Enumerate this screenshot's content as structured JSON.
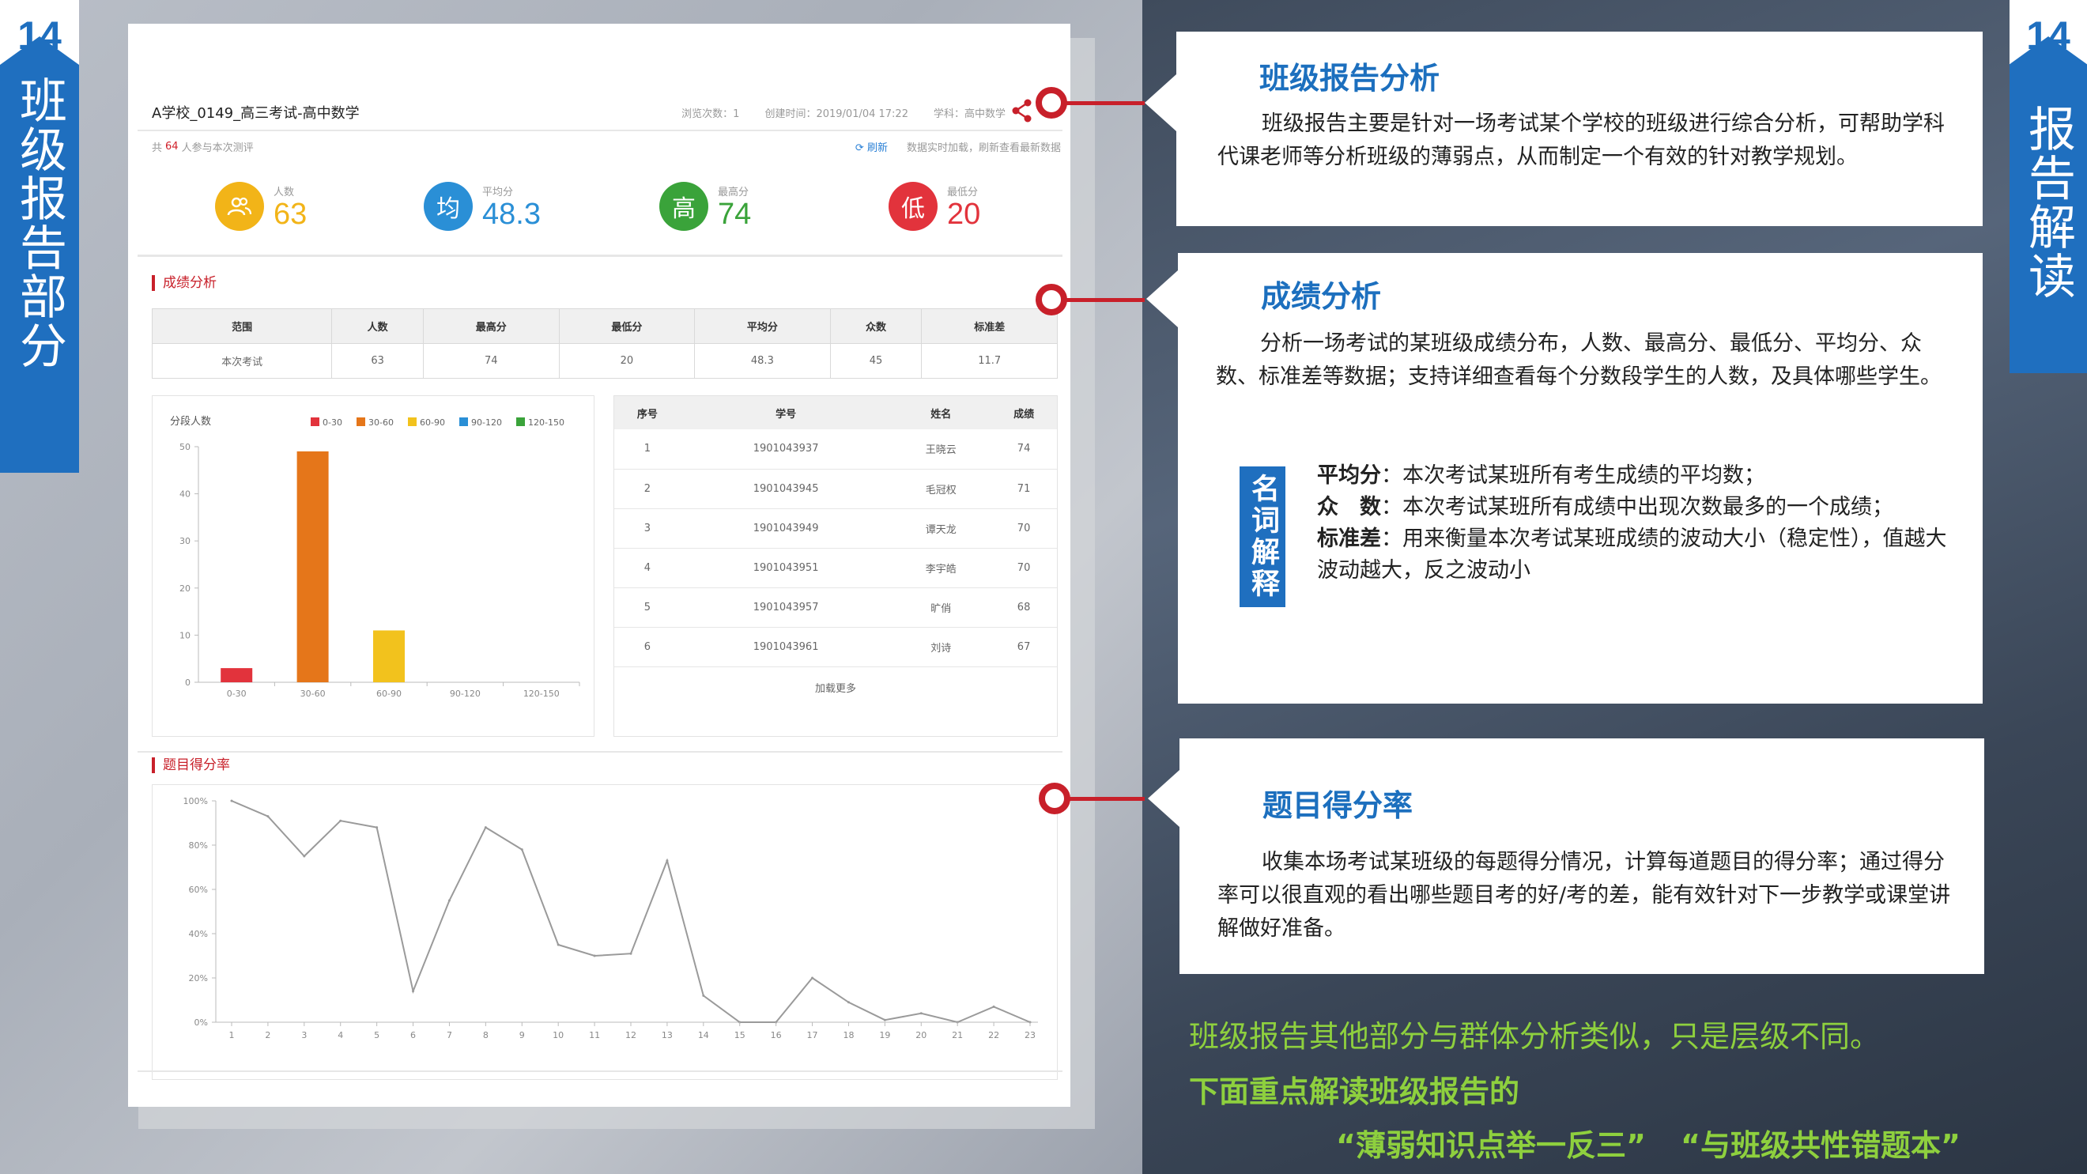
{
  "left_tab": {
    "number": "14",
    "text": "班级报告部分"
  },
  "right_tab": {
    "number": "14",
    "text": "报告解读"
  },
  "screen": {
    "title": "A学校_0149_高三考试-高中数学",
    "meta": [
      "浏览次数：1",
      "创建时间：2019/01/04 17:22",
      "学科：高中数学"
    ],
    "sub_prefix": "共",
    "sub_count": "64",
    "sub_suffix": "人参与本次测评",
    "refresh": "刷新",
    "realtime_note": "数据实时加载，刷新查看最新数据",
    "kpis": [
      {
        "icon": "users-icon",
        "symbol": "",
        "label": "人数",
        "value": "63",
        "color": "#f2b418"
      },
      {
        "icon": "average-icon",
        "symbol": "均",
        "label": "平均分",
        "value": "48.3",
        "color": "#2a8fd6"
      },
      {
        "icon": "high-icon",
        "symbol": "高",
        "label": "最高分",
        "value": "74",
        "color": "#3aa33a"
      },
      {
        "icon": "low-icon",
        "symbol": "低",
        "label": "最低分",
        "value": "20",
        "color": "#e2333c"
      }
    ],
    "score_section": "成绩分析",
    "stats_headers": [
      "范围",
      "人数",
      "最高分",
      "最低分",
      "平均分",
      "众数",
      "标准差"
    ],
    "stats_row": [
      "本次考试",
      "63",
      "74",
      "20",
      "48.3",
      "45",
      "11.7"
    ],
    "list_headers": [
      "序号",
      "学号",
      "姓名",
      "成绩"
    ],
    "list_rows": [
      [
        "1",
        "1901043937",
        "王晓云",
        "74"
      ],
      [
        "2",
        "1901043945",
        "毛冠权",
        "71"
      ],
      [
        "3",
        "1901043949",
        "谭天龙",
        "70"
      ],
      [
        "4",
        "1901043951",
        "李宇皓",
        "70"
      ],
      [
        "5",
        "1901043957",
        "旷俏",
        "68"
      ],
      [
        "6",
        "1901043961",
        "刘诗",
        "67"
      ]
    ],
    "load_more": "加载更多",
    "rate_section": "题目得分率"
  },
  "chart_data": [
    {
      "type": "bar",
      "title": "分段人数",
      "categories": [
        "0-30",
        "30-60",
        "60-90",
        "90-120",
        "120-150"
      ],
      "values": [
        3,
        49,
        11,
        0,
        0
      ],
      "colors": [
        "#e2333c",
        "#e5761a",
        "#f2c21d",
        "#2a8fd6",
        "#3aa33a"
      ],
      "legend": [
        "0-30",
        "30-60",
        "60-90",
        "90-120",
        "120-150"
      ],
      "legend_position": "top-right",
      "ylim": [
        0,
        50
      ],
      "yticks": [
        0,
        10,
        20,
        30,
        40,
        50
      ]
    },
    {
      "type": "line",
      "x": [
        1,
        2,
        3,
        4,
        5,
        6,
        7,
        8,
        9,
        10,
        11,
        12,
        13,
        14,
        15,
        16,
        17,
        18,
        19,
        20,
        21,
        22,
        23
      ],
      "values": [
        100,
        93,
        75,
        91,
        88,
        14,
        55,
        88,
        78,
        35,
        30,
        31,
        73,
        12,
        0,
        0,
        20,
        9,
        1,
        4,
        0,
        7,
        0
      ],
      "yticks": [
        "0%",
        "20%",
        "40%",
        "60%",
        "80%",
        "100%"
      ],
      "ylim": [
        0,
        100
      ],
      "color": "#9a9a9a"
    }
  ],
  "cards": [
    {
      "title": "班级报告分析",
      "body": "班级报告主要是针对一场考试某个学校的班级进行综合分析，可帮助学科代课老师等分析班级的薄弱点，从而制定一个有效的针对教学规划。"
    },
    {
      "title": "成绩分析",
      "body": "分析一场考试的某班级成绩分布，人数、最高分、最低分、平均分、众数、标准差等数据；支持详细查看每个分数段学生的人数，及具体哪些学生。"
    },
    {
      "title": "题目得分率",
      "body": "收集本场考试某班级的每题得分情况，计算每道题目的得分率；通过得分率可以很直观的看出哪些题目考的好/考的差，能有效针对下一步教学或课堂讲解做好准备。"
    }
  ],
  "terms_label": "名词解释",
  "terms": [
    {
      "term": "平均分",
      "text": "：本次考试某班所有考生成绩的平均数；"
    },
    {
      "term": "众　数",
      "text": "：本次考试某班所有成绩中出现次数最多的一个成绩；"
    },
    {
      "term": "标准差",
      "text": "：用来衡量本次考试某班成绩的波动大小（稳定性），值越大　　　　波动越大，反之波动小"
    }
  ],
  "footer": {
    "line1": "班级报告其他部分与群体分析类似，只是层级不同。",
    "line2": "下面重点解读班级报告的",
    "line3a": "“薄弱知识点举一反三”",
    "line3b": "“与班级共性错题本”"
  },
  "colors": {
    "brand_blue": "#1f6fbf",
    "accent_red": "#c8202a",
    "footer_green": "#8ed03e"
  }
}
